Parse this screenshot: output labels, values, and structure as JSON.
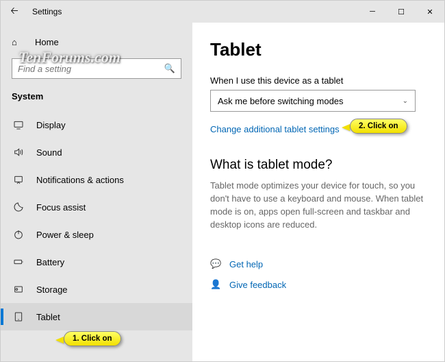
{
  "titlebar": {
    "title": "Settings"
  },
  "sidebar": {
    "home": "Home",
    "search_placeholder": "Find a setting",
    "section": "System",
    "items": [
      {
        "label": "Display"
      },
      {
        "label": "Sound"
      },
      {
        "label": "Notifications & actions"
      },
      {
        "label": "Focus assist"
      },
      {
        "label": "Power & sleep"
      },
      {
        "label": "Battery"
      },
      {
        "label": "Storage"
      },
      {
        "label": "Tablet"
      }
    ]
  },
  "main": {
    "heading": "Tablet",
    "dropdown_label": "When I use this device as a tablet",
    "dropdown_value": "Ask me before switching modes",
    "change_link": "Change additional tablet settings",
    "subheading": "What is tablet mode?",
    "description": "Tablet mode optimizes your device for touch, so you don't have to use a keyboard and mouse. When tablet mode is on, apps open full-screen and taskbar and desktop icons are reduced.",
    "get_help": "Get help",
    "give_feedback": "Give feedback"
  },
  "callouts": {
    "one": "1. Click on",
    "two": "2. Click on"
  },
  "watermark": "TenForums.com"
}
